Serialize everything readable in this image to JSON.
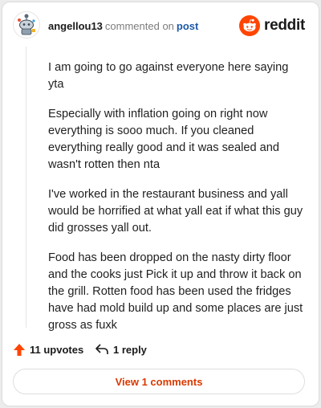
{
  "comment": {
    "username": "angellou13",
    "action_text": "commented on",
    "post_link": "post",
    "paragraphs": [
      "I am going to go against everyone here saying yta",
      "Especially with inflation going on right now everything is sooo much. If you cleaned everything really good and it was sealed and wasn't rotten then nta",
      "I've worked in the restaurant business and yall would be horrified at what yall eat if what this guy did grosses yall out.",
      "Food has been dropped on the nasty dirty floor and the cooks just Pick it up and throw it back on the grill. Rotten food has been used the fridges have had mold build up and some places are just gross as fuxk"
    ]
  },
  "brand": {
    "wordmark": "reddit",
    "icon": "reddit-snoo-icon",
    "color": "#ff4500"
  },
  "actions": {
    "upvotes_label": "11 upvotes",
    "upvote_icon": "upvote-arrow-icon",
    "reply_label": "1 reply",
    "reply_icon": "reply-arrow-icon"
  },
  "view_comments_label": "View 1 comments",
  "colors": {
    "accent": "#d93a00",
    "upvote": "#ff4500",
    "link": "#1e5aa8",
    "muted": "#7c7c7c"
  }
}
